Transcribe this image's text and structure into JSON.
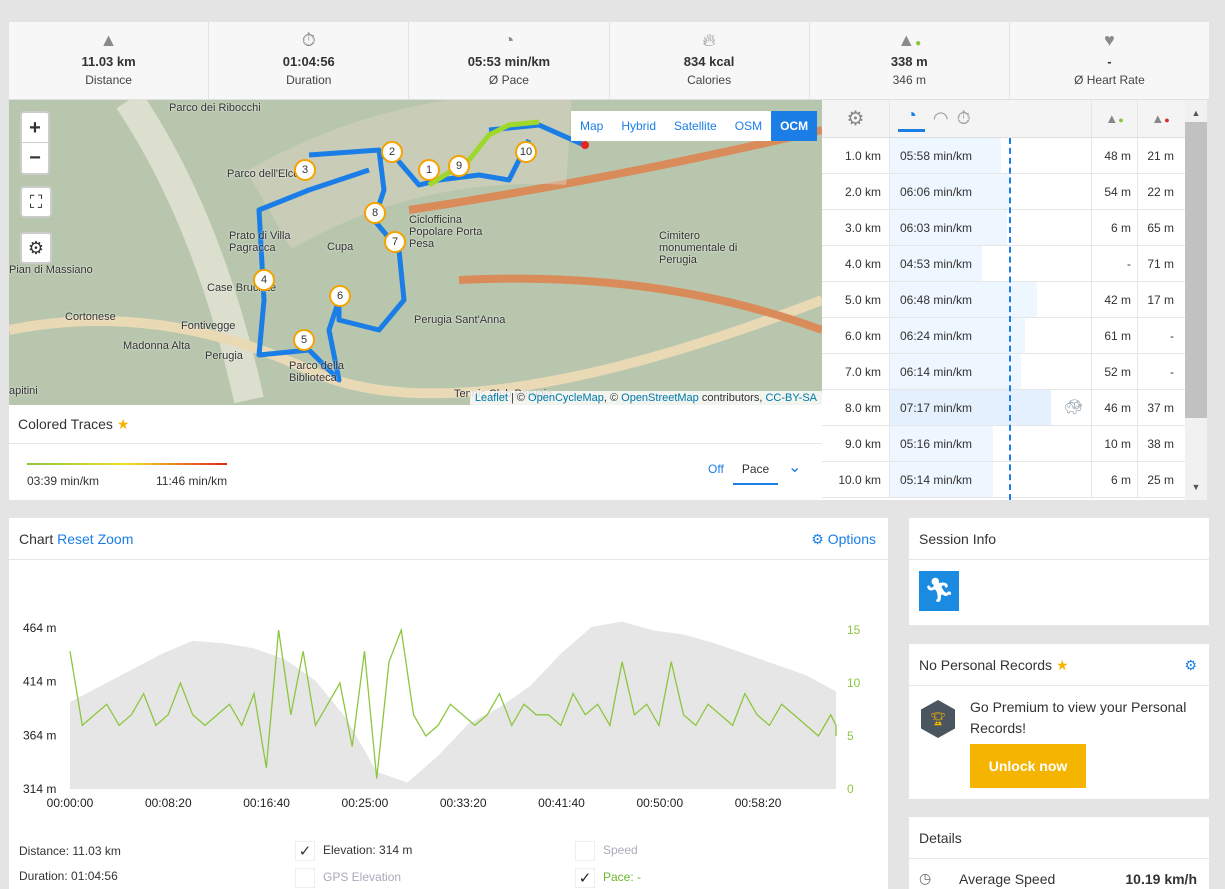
{
  "stats": [
    {
      "icon": "road-icon",
      "value": "11.03 km",
      "label": "Distance"
    },
    {
      "icon": "stopwatch-icon",
      "value": "01:04:56",
      "label": "Duration"
    },
    {
      "icon": "pace-icon",
      "value": "05:53 min/km",
      "label": "Ø Pace"
    },
    {
      "icon": "flame-icon",
      "value": "834 kcal",
      "label": "Calories"
    },
    {
      "icon": "elevation-up-icon",
      "value": "338 m",
      "label": "346 m"
    },
    {
      "icon": "heart-icon",
      "value": "-",
      "label": "Ø Heart Rate"
    }
  ],
  "map": {
    "zoom_in": "+",
    "zoom_out": "−",
    "layers": [
      "Map",
      "Hybrid",
      "Satellite",
      "OSM",
      "OCM"
    ],
    "active_layer": "OCM",
    "labels": [
      "Parco dei Ribocchi",
      "Parco dell'Elce",
      "Prato di Villa Pagracca",
      "Pian di Massiano",
      "Case Bruciate",
      "Cortonese",
      "Fontivegge",
      "Madonna Alta",
      "Perugia",
      "Cupa",
      "Ciclofficina Popolare Porta Pesa",
      "Perugia Sant'Anna",
      "Cimitero monumentale di Perugia",
      "Tennis Club Perugia",
      "Parco della Biblioteca",
      "apitini"
    ],
    "markers": [
      "1",
      "2",
      "3",
      "4",
      "5",
      "6",
      "7",
      "8",
      "9",
      "10"
    ],
    "attribution": {
      "leaflet": "Leaflet",
      "sep1": " | © ",
      "ocm": "OpenCycleMap",
      "sep2": ", © ",
      "osm": "OpenStreetMap",
      "sep3": " contributors, ",
      "lic": "CC-BY-SA"
    }
  },
  "traces": {
    "title": "Colored Traces",
    "min": "03:39 min/km",
    "max": "11:46 min/km",
    "off": "Off",
    "selected": "Pace"
  },
  "splits": {
    "colors": {
      "bar": "#eef6ff",
      "avg_line": "#1a7ee6"
    },
    "rows": [
      {
        "km": "1.0 km",
        "pace": "05:58 min/km",
        "up": "48 m",
        "down": "21 m",
        "pct": 0.55
      },
      {
        "km": "2.0 km",
        "pace": "06:06 min/km",
        "up": "54 m",
        "down": "22 m",
        "pct": 0.59
      },
      {
        "km": "3.0 km",
        "pace": "06:03 min/km",
        "up": "6 m",
        "down": "65 m",
        "pct": 0.58
      },
      {
        "km": "4.0 km",
        "pace": "04:53 min/km",
        "up": "-",
        "down": "71 m",
        "pct": 0.46
      },
      {
        "km": "5.0 km",
        "pace": "06:48 min/km",
        "up": "42 m",
        "down": "17 m",
        "pct": 0.73
      },
      {
        "km": "6.0 km",
        "pace": "06:24 min/km",
        "up": "61 m",
        "down": "-",
        "pct": 0.67
      },
      {
        "km": "7.0 km",
        "pace": "06:14 min/km",
        "up": "52 m",
        "down": "-",
        "pct": 0.65
      },
      {
        "km": "8.0 km",
        "pace": "07:17 min/km",
        "up": "46 m",
        "down": "37 m",
        "pct": 0.8,
        "slowest": true
      },
      {
        "km": "9.0 km",
        "pace": "05:16 min/km",
        "up": "10 m",
        "down": "38 m",
        "pct": 0.51
      },
      {
        "km": "10.0 km",
        "pace": "05:14 min/km",
        "up": "6 m",
        "down": "25 m",
        "pct": 0.51
      }
    ]
  },
  "chart": {
    "title": "Chart",
    "reset": "Reset Zoom",
    "options": "Options",
    "distance": "Distance: 11.03 km",
    "duration": "Duration: 01:04:56",
    "toggles": [
      {
        "label": "Elevation: 314 m",
        "checked": true
      },
      {
        "label": "GPS Elevation",
        "checked": false
      },
      {
        "label": "Speed",
        "checked": false
      },
      {
        "label": "Pace: -",
        "checked": true
      }
    ]
  },
  "chart_data": {
    "type": "area",
    "x_ticks": [
      "00:00:00",
      "00:08:20",
      "00:16:40",
      "00:25:00",
      "00:33:20",
      "00:41:40",
      "00:50:00",
      "00:58:20"
    ],
    "y_left_ticks": [
      "314 m",
      "364 m",
      "414 m",
      "464 m"
    ],
    "y_right_ticks": [
      "0",
      "5",
      "10",
      "15"
    ],
    "ylim_left": [
      314,
      464
    ],
    "ylim_right": [
      0,
      15
    ],
    "colors": {
      "elevation": "#e6e6e6",
      "pace": "#8cc63f"
    },
    "elevation": {
      "t_min": [
        0,
        2.5,
        5,
        7.5,
        10,
        12.5,
        15,
        17.5,
        20,
        22.5,
        25,
        27.5,
        30,
        32.5,
        35,
        37.5,
        40,
        42.5,
        45,
        47.5,
        50,
        52.5,
        55,
        57.5,
        60,
        62.5,
        65
      ],
      "m": [
        395,
        410,
        425,
        440,
        452,
        450,
        445,
        435,
        415,
        380,
        330,
        320,
        345,
        375,
        390,
        410,
        440,
        465,
        470,
        462,
        458,
        450,
        440,
        430,
        420,
        405,
        395
      ]
    },
    "pace": {
      "t_min": [
        0,
        1,
        2,
        3,
        4,
        5,
        6,
        7,
        8,
        9,
        10,
        11,
        12,
        13,
        14,
        15,
        16,
        17,
        18,
        19,
        20,
        21,
        22,
        23,
        24,
        25,
        26,
        27,
        28,
        29,
        30,
        31,
        32,
        33,
        34,
        35,
        36,
        37,
        38,
        39,
        40,
        41,
        42,
        43,
        44,
        45,
        46,
        47,
        48,
        49,
        50,
        51,
        52,
        53,
        54,
        55,
        56,
        57,
        58,
        59,
        60,
        61,
        62,
        63,
        64,
        65
      ],
      "v": [
        13,
        6,
        7,
        8,
        6,
        7,
        9,
        6,
        7,
        10,
        7,
        6,
        7,
        8,
        6,
        9,
        2,
        15,
        7,
        13,
        6,
        8,
        10,
        4,
        13,
        1,
        12,
        15,
        7,
        5,
        6,
        8,
        7,
        6,
        7,
        9,
        6,
        8,
        7,
        7,
        6,
        9,
        7,
        8,
        6,
        12,
        7,
        8,
        6,
        12,
        7,
        6,
        8,
        7,
        6,
        9,
        7,
        6,
        8,
        7,
        6,
        5,
        7,
        6,
        5,
        5
      ]
    }
  },
  "session": {
    "title": "Session Info",
    "sport_icon": "running-icon"
  },
  "records": {
    "title": "No Personal Records",
    "text": "Go Premium to view your Personal Records!",
    "button": "Unlock now"
  },
  "details": {
    "title": "Details",
    "row_label": "Average Speed",
    "row_value": "10.19 km/h"
  }
}
